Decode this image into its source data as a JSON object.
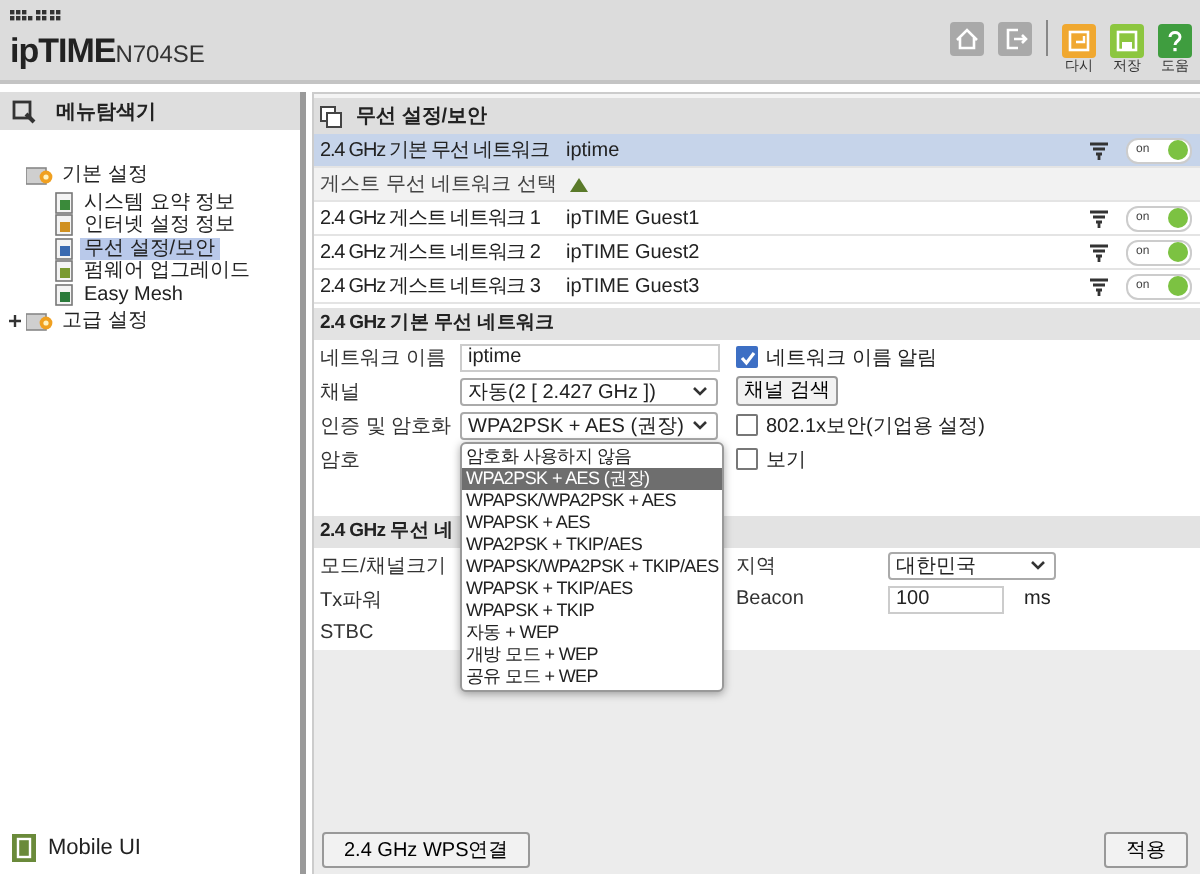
{
  "header": {
    "brand": "ipTIME",
    "model": "N704SE",
    "tools": [
      {
        "kind": "undo",
        "label": "다시"
      },
      {
        "kind": "save",
        "label": "저장"
      },
      {
        "kind": "help",
        "label": "도움"
      }
    ]
  },
  "sidebar": {
    "title": "메뉴탐색기",
    "tree": [
      {
        "label": "기본 설정",
        "expanded": true,
        "selected": false,
        "children": [
          {
            "label": "시스템 요약 정보",
            "selected": false
          },
          {
            "label": "인터넷 설정 정보",
            "selected": false
          },
          {
            "label": "무선 설정/보안",
            "selected": true
          },
          {
            "label": "펌웨어 업그레이드",
            "selected": false
          },
          {
            "label": "Easy Mesh",
            "selected": false
          }
        ]
      },
      {
        "label": "고급 설정",
        "expanded": false,
        "selected": false
      }
    ],
    "footer": "Mobile UI"
  },
  "wireless": {
    "title": "무선 설정/보안",
    "networks": [
      {
        "label": "2.4 GHz 기본 무선 네트워크",
        "ssid": "iptime",
        "selected": true,
        "on": true,
        "switch_label": "on"
      }
    ],
    "guest": {
      "label": "게스트 무선 네트워크 선택",
      "expanded": true,
      "networks": [
        {
          "label": "2.4 GHz 게스트 네트워크 1",
          "ssid": "ipTIME Guest1",
          "selected": false,
          "on": true,
          "switch_label": "on"
        },
        {
          "label": "2.4 GHz 게스트 네트워크 2",
          "ssid": "ipTIME Guest2",
          "selected": false,
          "on": true,
          "switch_label": "on"
        },
        {
          "label": "2.4 GHz 게스트 네트워크 3",
          "ssid": "ipTIME Guest3",
          "selected": false,
          "on": true,
          "switch_label": "on"
        }
      ]
    }
  },
  "basic": {
    "title": "2.4 GHz 기본 무선 네트워크",
    "fields": [
      {
        "label": "네트워크 이름",
        "control": {
          "kind": "text",
          "value": "iptime"
        },
        "extra": {
          "kind": "checkbox",
          "label": "네트워크 이름 알림",
          "checked": true
        }
      },
      {
        "label": "채널",
        "control": {
          "kind": "select",
          "value": "자동(2 [ 2.427 GHz ])"
        },
        "extra": {
          "kind": "button",
          "label": "채널 검색"
        }
      },
      {
        "label": "인증 및 암호화",
        "control": {
          "kind": "select",
          "value": "WPA2PSK + AES (권장)",
          "expanded": true,
          "options": [
            {
              "label": "암호화 사용하지 않음",
              "selected": false
            },
            {
              "label": "WPA2PSK + AES (권장)",
              "selected": true
            },
            {
              "label": "WPAPSK/WPA2PSK + AES",
              "selected": false
            },
            {
              "label": "WPAPSK + AES",
              "selected": false
            },
            {
              "label": "WPA2PSK + TKIP/AES",
              "selected": false
            },
            {
              "label": "WPAPSK/WPA2PSK + TKIP/AES",
              "selected": false
            },
            {
              "label": "WPAPSK + TKIP/AES",
              "selected": false
            },
            {
              "label": "WPAPSK + TKIP",
              "selected": false
            },
            {
              "label": "자동 + WEP",
              "selected": false
            },
            {
              "label": "개방 모드 + WEP",
              "selected": false
            },
            {
              "label": "공유 모드 + WEP",
              "selected": false
            }
          ]
        },
        "extra": {
          "kind": "checkbox",
          "label": "802.1x보안(기업용 설정)",
          "checked": false
        }
      },
      {
        "label": "암호",
        "extra": {
          "kind": "checkbox",
          "label": "보기",
          "checked": false
        }
      }
    ]
  },
  "advanced": {
    "title": "2.4 GHz 무선 네",
    "rows": [
      {
        "label": "모드/채널크기",
        "extra_label": "지역",
        "extra": {
          "kind": "select",
          "value": "대한민국"
        }
      },
      {
        "label": "Tx파워",
        "extra_label": "Beacon",
        "extra": {
          "kind": "text",
          "value": "100",
          "unit": "ms"
        }
      },
      {
        "label": "STBC"
      }
    ]
  },
  "footer": {
    "left_button": "2.4 GHz WPS연결",
    "right_button": "적용"
  }
}
